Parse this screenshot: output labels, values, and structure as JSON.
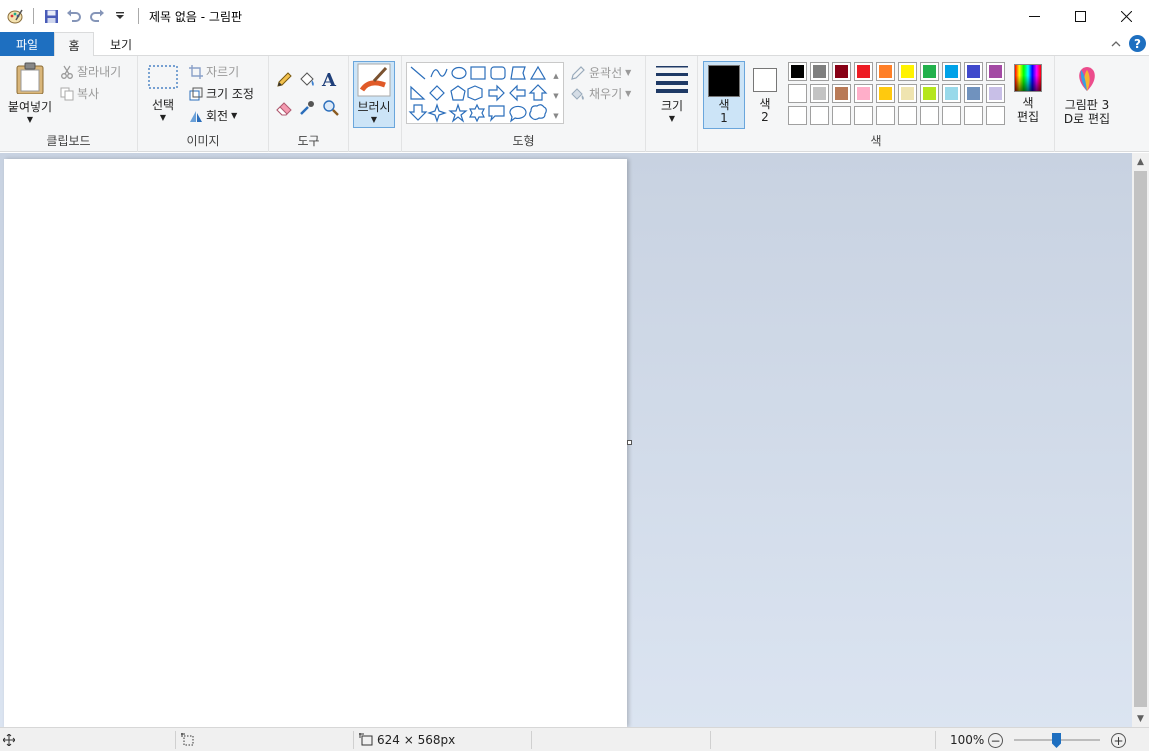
{
  "window": {
    "title": "제목 없음 - 그림판",
    "minimize_icon": "minimize-icon",
    "maximize_icon": "maximize-icon",
    "close_icon": "close-icon"
  },
  "quick_access": {
    "icons": [
      "paint-app-icon",
      "save-icon",
      "undo-icon",
      "redo-icon",
      "customize-dropdown-icon"
    ]
  },
  "tabs": [
    {
      "label": "파일"
    },
    {
      "label": "홈"
    },
    {
      "label": "보기"
    }
  ],
  "ribbon": {
    "clipboard": {
      "group_label": "클립보드",
      "paste": "붙여넣기",
      "cut": "잘라내기",
      "copy": "복사"
    },
    "image": {
      "group_label": "이미지",
      "select": "선택",
      "crop": "자르기",
      "resize": "크기 조정",
      "rotate": "회전"
    },
    "tools": {
      "group_label": "도구"
    },
    "brushes": {
      "label": "브러시"
    },
    "shapes": {
      "group_label": "도형",
      "outline": "윤곽선",
      "fill": "채우기"
    },
    "size": {
      "label": "크기"
    },
    "colors": {
      "group_label": "색",
      "color1_label": "색",
      "color1_num": "1",
      "color2_label": "색",
      "color2_num": "2",
      "edit_colors_l1": "색",
      "edit_colors_l2": "편집",
      "color1": "#000000",
      "color2": "#ffffff",
      "palette_row1": [
        "#000000",
        "#7f7f7f",
        "#880015",
        "#ed1c24",
        "#ff7f27",
        "#fff200",
        "#22b14c",
        "#00a2e8",
        "#3f48cc",
        "#a349a4"
      ],
      "palette_row2": [
        "#ffffff",
        "#c3c3c3",
        "#b97a57",
        "#ffaec9",
        "#ffc90e",
        "#efe4b0",
        "#b5e61d",
        "#99d9ea",
        "#7092be",
        "#c8bfe7"
      ]
    },
    "paint3d": {
      "label_l1": "그림판 3",
      "label_l2": "D로 편집"
    }
  },
  "status": {
    "canvas_size": "624 × 568px",
    "zoom": "100%",
    "zoom_level": 0.5
  }
}
